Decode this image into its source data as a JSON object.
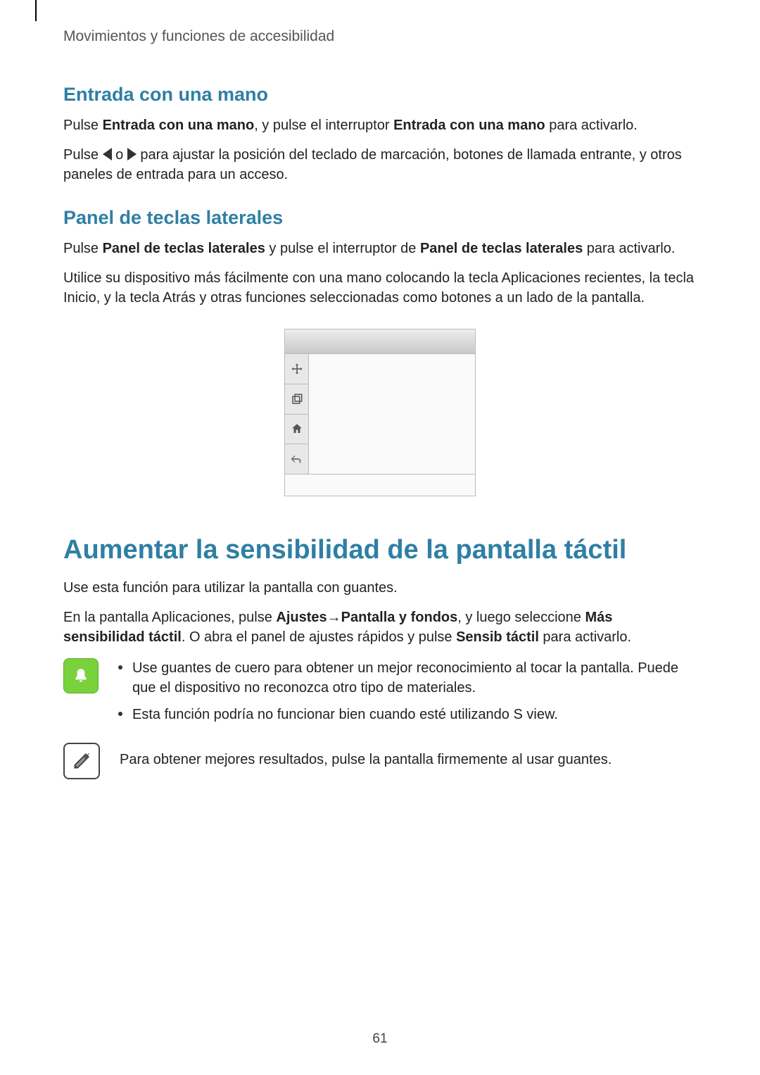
{
  "header": "Movimientos y funciones de accesibilidad",
  "section1": {
    "heading": "Entrada con una mano",
    "p1_a": "Pulse ",
    "p1_b": "Entrada con una mano",
    "p1_c": ", y pulse el interruptor ",
    "p1_d": "Entrada con una mano",
    "p1_e": " para activarlo.",
    "p2_a": "Pulse ",
    "p2_b": " o ",
    "p2_c": " para ajustar la posición del teclado de marcación, botones de llamada entrante, y otros paneles de entrada para un acceso."
  },
  "section2": {
    "heading": "Panel de teclas laterales",
    "p1_a": "Pulse ",
    "p1_b": "Panel de teclas laterales",
    "p1_c": " y pulse el interruptor de ",
    "p1_d": "Panel de teclas laterales",
    "p1_e": " para activarlo.",
    "p2": "Utilice su dispositivo más fácilmente con una mano colocando la tecla Aplicaciones recientes, la tecla Inicio, y la tecla Atrás y otras funciones seleccionadas como botones a un lado de la pantalla."
  },
  "section3": {
    "heading": "Aumentar la sensibilidad de la pantalla táctil",
    "p1": "Use esta función para utilizar la pantalla con guantes.",
    "p2_a": "En la pantalla Aplicaciones, pulse ",
    "p2_b": "Ajustes",
    "p2_sep": " → ",
    "p2_c": "Pantalla y fondos",
    "p2_d": ", y luego seleccione ",
    "p2_e": "Más sensibilidad táctil",
    "p2_f": ". O abra el panel de ajustes rápidos y pulse ",
    "p2_g": "Sensib táctil",
    "p2_h": " para activarlo.",
    "note1_b1": "Use guantes de cuero para obtener un mejor reconocimiento al tocar la pantalla. Puede que el dispositivo no reconozca otro tipo de materiales.",
    "note1_b2": "Esta función podría no funcionar bien cuando esté utilizando S view.",
    "note2": "Para obtener mejores resultados, pulse la pantalla firmemente al usar guantes."
  },
  "page_number": "61"
}
